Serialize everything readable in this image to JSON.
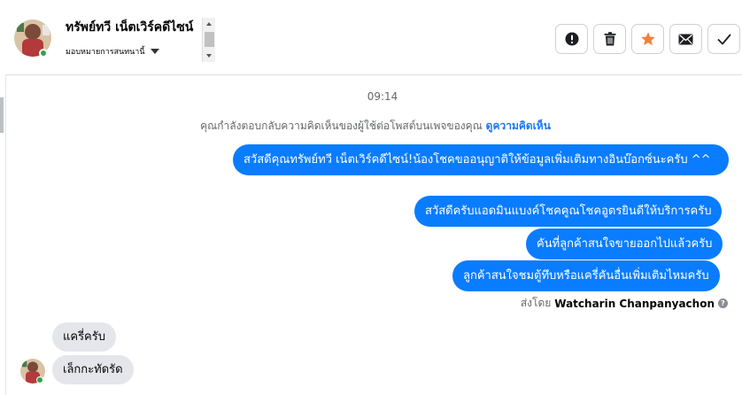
{
  "header": {
    "contact_name": "ทรัพย์ทวี เน็ตเวิร์คดีไซน์",
    "assign_label": "มอบหมายการสนทนานี้",
    "status_color": "#31a24c",
    "actions": [
      {
        "icon": "alert-icon",
        "label": "Mark as spam"
      },
      {
        "icon": "trash-icon",
        "label": "Delete"
      },
      {
        "icon": "star-icon",
        "label": "Star",
        "color": "#f0813a"
      },
      {
        "icon": "envelope-icon",
        "label": "Mark as unread"
      },
      {
        "icon": "check-icon",
        "label": "Done"
      }
    ]
  },
  "conversation": {
    "timestamp": "09:14",
    "notice_text": "คุณกำลังตอบกลับความคิดเห็นของผู้ใช้ต่อโพสต์บนเพจของคุณ",
    "notice_link": "ดูความคิดเห็น",
    "outgoing": [
      "สวัสดีคุณทรัพย์ทวี เน็ตเวิร์คดีไซน์!น้องโชคขออนุญาติให้ข้อมูลเพิ่มเติมทางอินบ๊อกซ์นะครับ ^^",
      "สวัสดีครับแอดมินแบงค์โชคคูณโชคอูตรยินดีให้บริการครับ",
      "คันที่ลูกค้าสนใจขายออกไปแล้วครับ",
      "ลูกค้าสนใจชมตู้ทึบหรือแครี่คันอื่นเพิ่มเติมไหมครับ"
    ],
    "sent_by_label": "ส่งโดย",
    "sent_by_agent": "Watcharin Chanpanyachon",
    "incoming": [
      "แครี่ครับ",
      "เล็กกะทัดรัด"
    ],
    "outgoing_color": "#0a7cff",
    "incoming_color": "#e4e6eb"
  }
}
